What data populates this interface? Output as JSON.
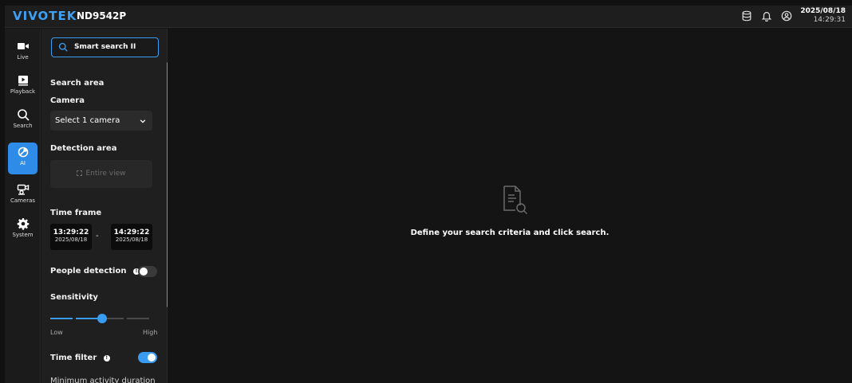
{
  "header": {
    "brand": "VIVOTEK",
    "model": "ND9542P",
    "date": "2025/08/18",
    "time": "14:29:31",
    "icons": [
      "storage-icon",
      "bell-icon",
      "user-icon"
    ]
  },
  "nav": {
    "items": [
      {
        "label": "Live",
        "icon": "video-camera-icon"
      },
      {
        "label": "Playback",
        "icon": "playback-icon"
      },
      {
        "label": "Search",
        "icon": "search-icon"
      },
      {
        "label": "AI",
        "icon": "ai-icon",
        "active": true
      },
      {
        "label": "Cameras",
        "icon": "cameras-icon"
      },
      {
        "label": "System",
        "icon": "gear-icon"
      }
    ]
  },
  "panel": {
    "tab_label": "Smart search II",
    "search_area": "Search area",
    "camera_label": "Camera",
    "camera_value": "Select 1 camera",
    "detection_area": "Detection area",
    "entire_view": "Entire view",
    "time_frame": "Time frame",
    "start_time": "13:29:22",
    "start_date": "2025/08/18",
    "dash": "-",
    "end_time": "14:29:22",
    "end_date": "2025/08/18",
    "people_detection": "People detection",
    "people_detection_on": false,
    "sensitivity": "Sensitivity",
    "sensitivity_low": "Low",
    "sensitivity_high": "High",
    "sensitivity_level": 3,
    "sensitivity_levels": 5,
    "time_filter": "Time filter",
    "time_filter_on": true,
    "min_duration": "Minimum activity duration"
  },
  "content": {
    "empty_message": "Define your search criteria and click search."
  },
  "colors": {
    "accent": "#3a9cf0",
    "brand": "#3ea0f2",
    "background": "#141414",
    "panel": "#1f1f1f"
  }
}
